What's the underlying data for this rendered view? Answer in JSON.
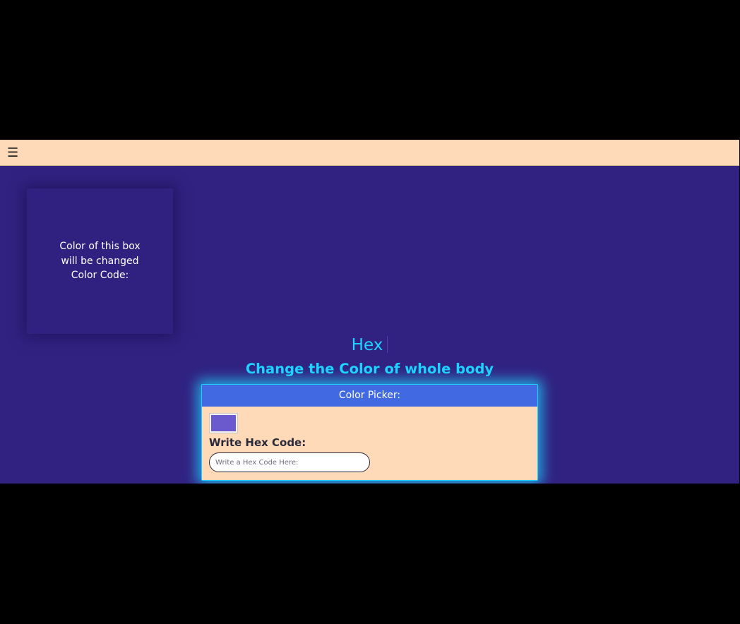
{
  "topbar": {
    "menu_icon": "hamburger-icon",
    "menu_glyph": "☰"
  },
  "color_box": {
    "line1": "Color of this box",
    "line2": "will be changed",
    "line3": "Color Code:"
  },
  "title": "Hex",
  "subtitle": "Change the Color of whole body",
  "picker": {
    "header": "Color Picker:",
    "swatch_color": "#6a5acd",
    "input_label": "Write Hex Code:",
    "input_placeholder": "Write a Hex Code Here:",
    "input_value": ""
  },
  "colors": {
    "background": "#312281",
    "topbar": "#ffdab9",
    "accent": "#1fd3ff",
    "picker_header": "#4169e1",
    "card": "#ffdab9"
  }
}
